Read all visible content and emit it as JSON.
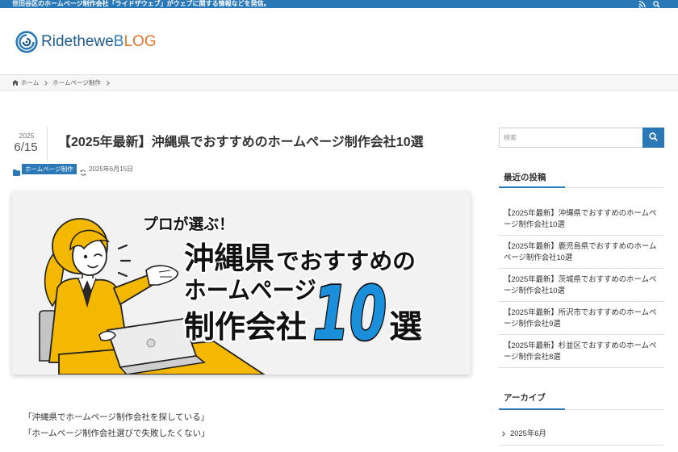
{
  "top_bar": {
    "tagline": "世田谷区のホームページ制作会社「ライドザウェブ」がウェブに関する情報などを発信。",
    "icons": [
      "rss-icon",
      "search-icon"
    ]
  },
  "logo": {
    "text_main": "Ridethewe",
    "text_b": "B",
    "text_log": "LOG",
    "icon": "swirl-logo-icon"
  },
  "breadcrumb": {
    "home": "ホーム",
    "category": "ホームページ制作"
  },
  "article": {
    "date_year": "2025",
    "date_md": "6/15",
    "title": "【2025年最新】沖縄県でおすすめのホームページ制作会社10選",
    "category": "ホームページ制作",
    "updated": "2025年6月15日",
    "eyecatch": {
      "lead": "プロが選ぶ！",
      "region": "沖縄県",
      "suffix": "でおすすめの",
      "line2": "ホームページ",
      "line3": "制作会社",
      "number": "10",
      "last": "選"
    },
    "intro": [
      "「沖縄県でホームページ制作会社を探している」",
      "「ホームページ制作会社選びで失敗したくない」"
    ]
  },
  "sidebar": {
    "search_placeholder": "検索",
    "recent_heading": "最近の投稿",
    "recent_items": [
      "【2025年最新】沖縄県でおすすめのホームページ制作会社10選",
      "【2025年最新】鹿児島県でおすすめのホームページ制作会社10選",
      "【2025年最新】茨城県でおすすめのホームページ制作会社10選",
      "【2025年最新】所沢市でおすすめのホームページ制作会社9選",
      "【2025年最新】杉並区でおすすめのホームページ制作会社8選"
    ],
    "archive_heading": "アーカイブ",
    "archive_items": [
      "2025年6月"
    ]
  },
  "colors": {
    "accent": "#2a79b6",
    "logo_navy": "#1e5a8c",
    "logo_orange": "#e8762b",
    "eyecatch_yellow": "#f5b800",
    "number_blue": "#1b8fd9"
  }
}
